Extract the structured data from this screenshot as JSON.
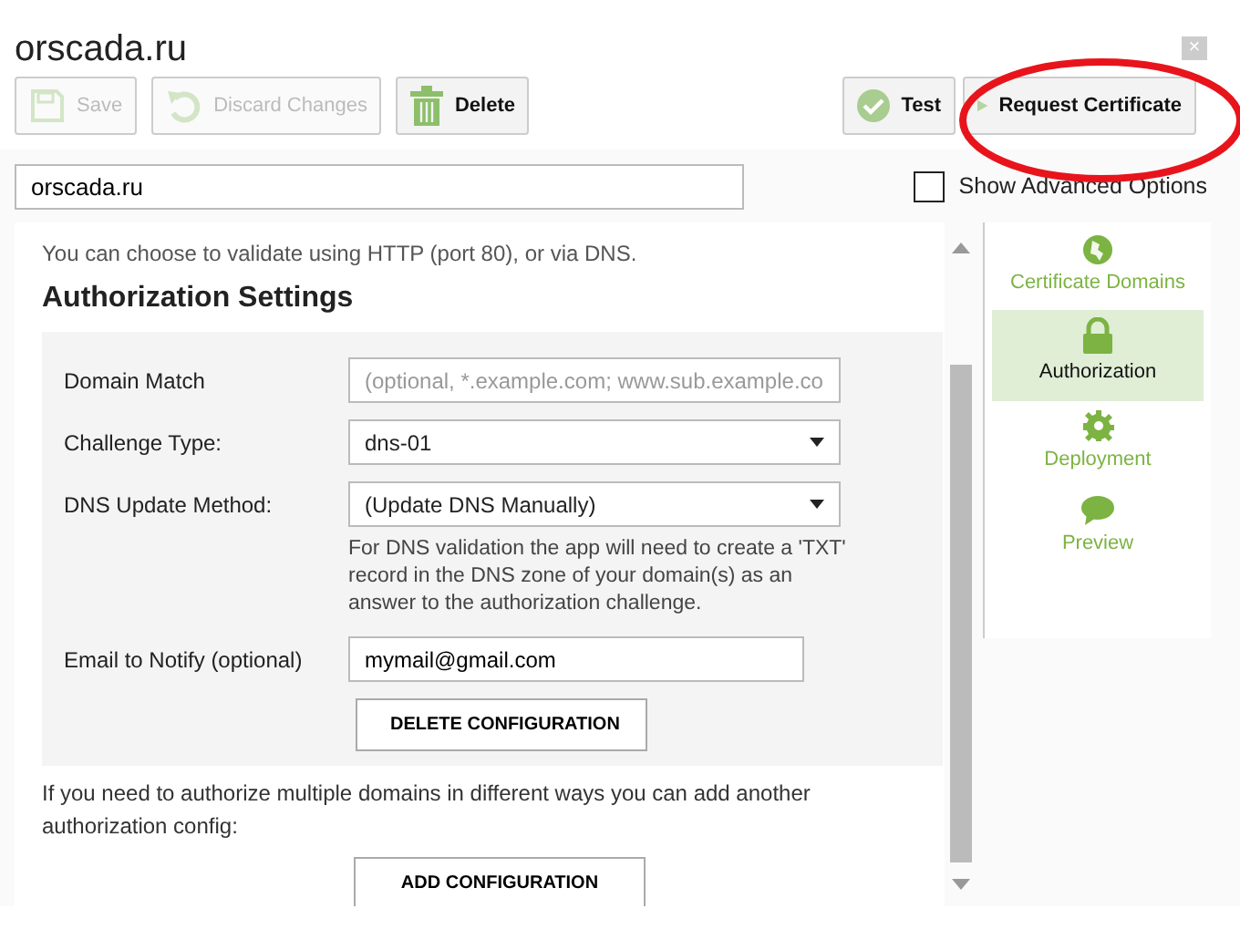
{
  "window": {
    "title": "orscada.ru",
    "close": "×"
  },
  "toolbar": {
    "left": [
      {
        "label": "Save",
        "disabled": true
      },
      {
        "label": "Discard Changes",
        "disabled": true
      },
      {
        "label": "Delete",
        "disabled": false
      }
    ],
    "right": [
      {
        "label": "Test",
        "disabled": false
      },
      {
        "label": "Request Certificate",
        "disabled": false
      }
    ]
  },
  "name_field": {
    "value": "orscada.ru"
  },
  "advanced_options": {
    "label": "Show Advanced Options",
    "checked": false
  },
  "intro": "You can choose to validate using HTTP (port 80), or via DNS.",
  "section_title": "Authorization Settings",
  "form": [
    {
      "kind": "text",
      "label": "Domain Match",
      "placeholder": "(optional, *.example.com; www.sub.example.co"
    },
    {
      "kind": "select",
      "label": "Challenge Type:",
      "value": "dns-01"
    },
    {
      "kind": "select",
      "label": "DNS Update Method:",
      "value": "(Update DNS Manually)",
      "help": "For DNS validation the app will need to create a 'TXT' record in the DNS zone of your domain(s) as an answer to the authorization challenge."
    },
    {
      "kind": "email",
      "label": "Email to Notify (optional)",
      "value": "mymail@gmail.com"
    }
  ],
  "delete_button": "DELETE CONFIGURATION",
  "footer_note": "If you need to authorize multiple domains in different ways you can add another authorization config:",
  "add_button": "ADD CONFIGURATION",
  "sidebar": [
    {
      "label": "Certificate Domains",
      "selected": false
    },
    {
      "label": "Authorization",
      "selected": true
    },
    {
      "label": "Deployment",
      "selected": false
    },
    {
      "label": "Preview",
      "selected": false
    }
  ],
  "annotation": {
    "kind": "ellipse",
    "color": "#e8141c"
  }
}
